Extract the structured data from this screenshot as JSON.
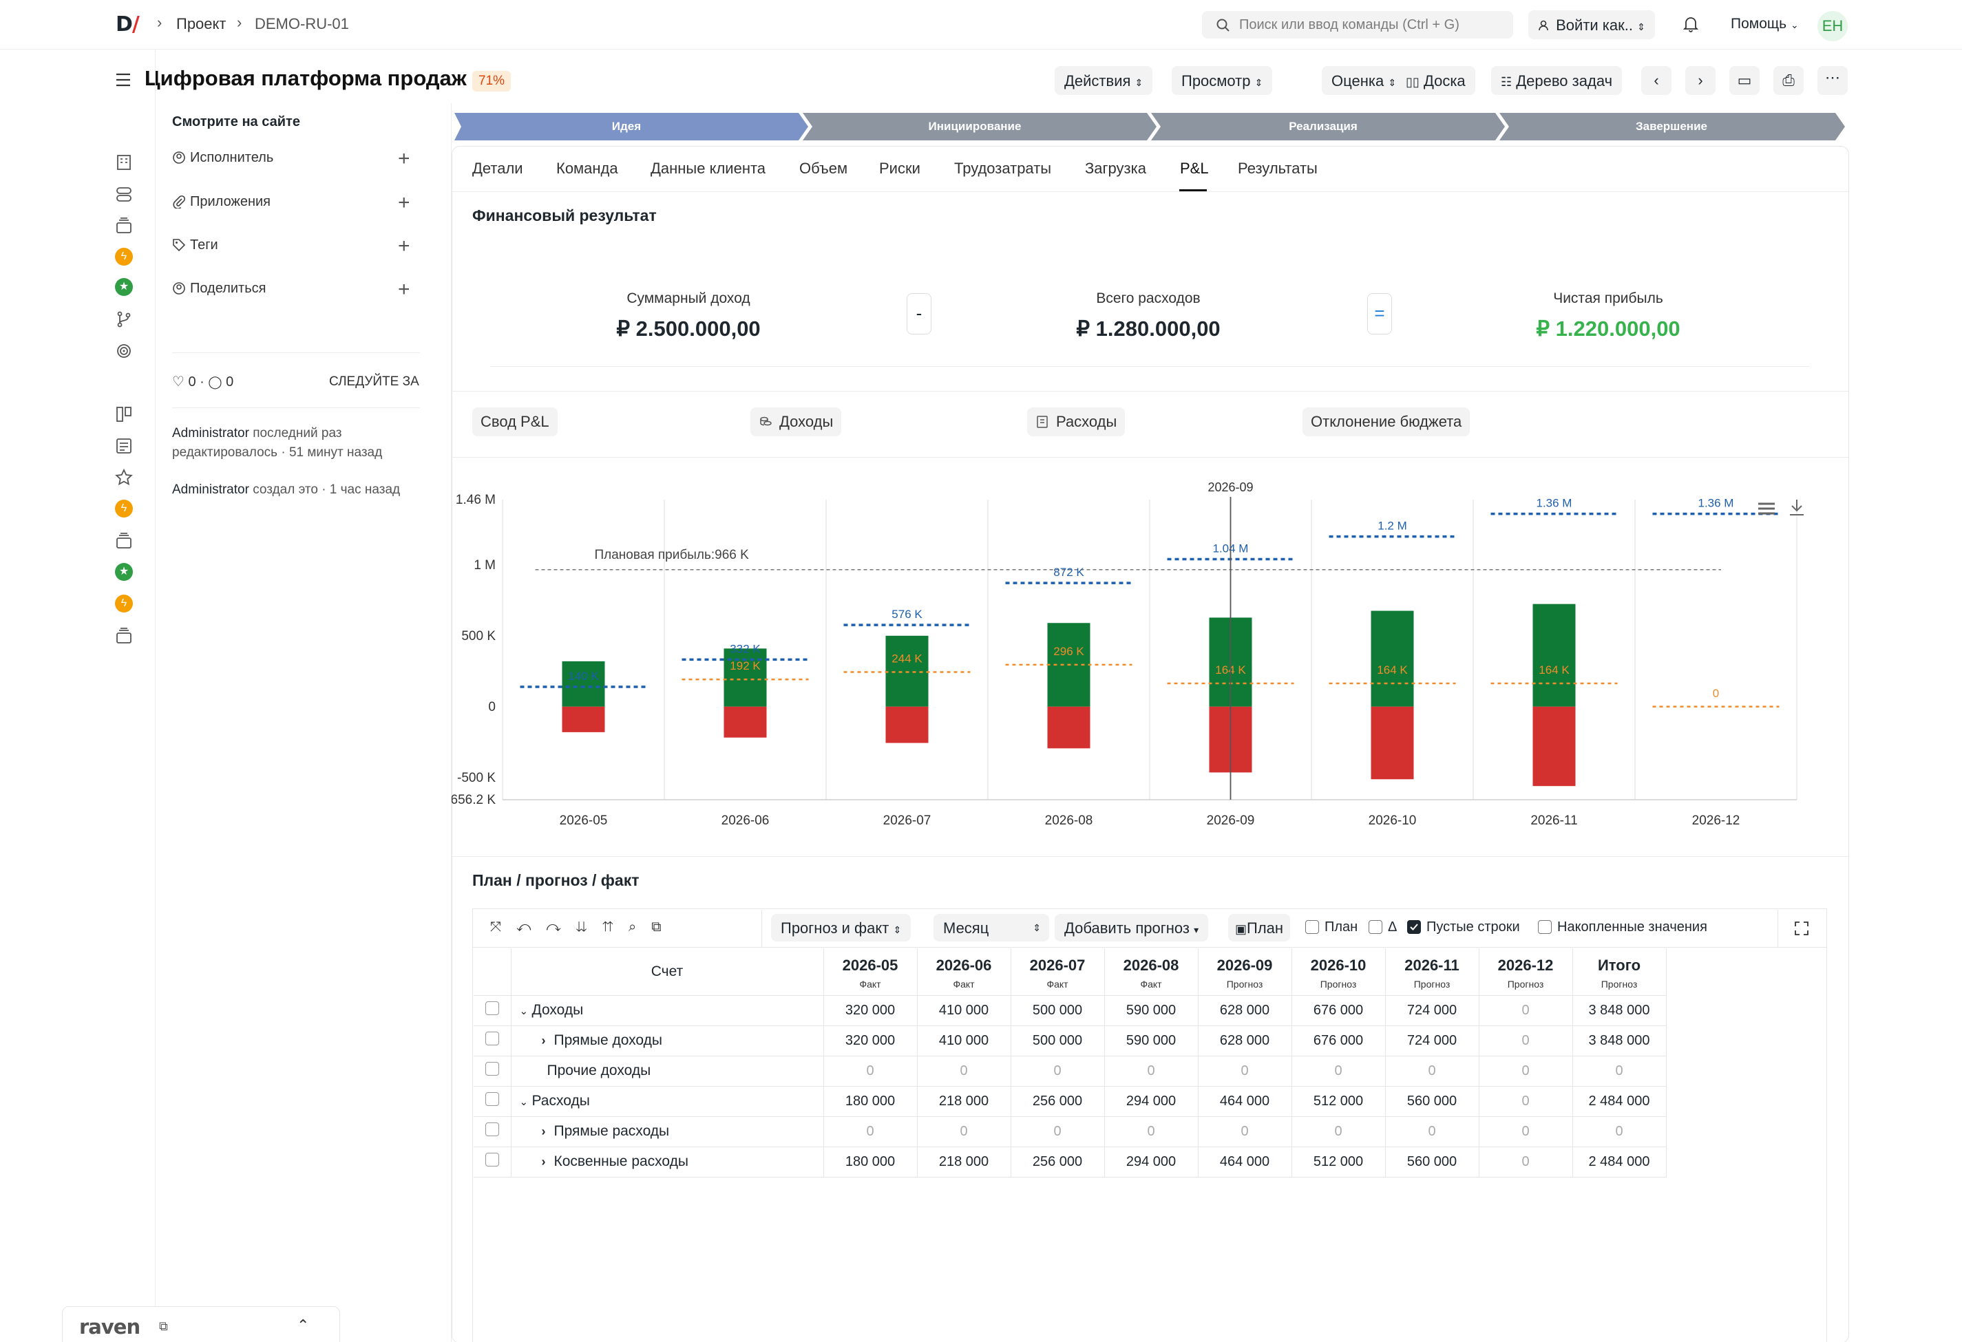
{
  "topbar": {
    "logo": "D/",
    "crumb_project": "Проект",
    "crumb_code": "DEMO-RU-01",
    "search_placeholder": "Поиск или ввод команды (Ctrl + G)",
    "login_as": "Войти как..",
    "help": "Помощь",
    "avatar": "EH"
  },
  "header": {
    "title": "Цифровая платформа продаж",
    "progress": "71%",
    "actions": [
      "Действия",
      "Просмотр",
      "Оценка",
      "Доска",
      "Дерево задач"
    ]
  },
  "sidebar": {
    "title": "Смотрите на сайте",
    "items": [
      {
        "label": "Исполнитель",
        "icon": "user-icon"
      },
      {
        "label": "Приложения",
        "icon": "paperclip-icon"
      },
      {
        "label": "Теги",
        "icon": "tag-icon"
      },
      {
        "label": "Поделиться",
        "icon": "share-icon"
      }
    ],
    "likes": "0",
    "comments": "0",
    "follow": "СЛЕДУЙТЕ ЗА",
    "activity": [
      {
        "who": "Administrator",
        "text": "последний раз редактировалось · 51 минут назад"
      },
      {
        "who": "Administrator",
        "text": "создал это · 1 час назад"
      }
    ]
  },
  "stages": [
    "Идея",
    "Инициирование",
    "Реализация",
    "Завершение"
  ],
  "tabs": [
    "Детали",
    "Команда",
    "Данные клиента",
    "Объем",
    "Риски",
    "Трудозатраты",
    "Загрузка",
    "P&L",
    "Результаты"
  ],
  "active_tab": "P&L",
  "financial": {
    "title": "Финансовый результат",
    "income_label": "Суммарный доход",
    "income": "₽ 2.500.000,00",
    "minus": "-",
    "expense_label": "Всего расходов",
    "expense": "₽ 1.280.000,00",
    "equals": "=",
    "profit_label": "Чистая прибыль",
    "profit": "₽ 1.220.000,00",
    "profit_color": "#37b24d"
  },
  "subtabs": [
    "Свод P&L",
    "Доходы",
    "Расходы",
    "Отклонение бюджета"
  ],
  "chart_data": {
    "type": "bar",
    "categories": [
      "2026-05",
      "2026-06",
      "2026-07",
      "2026-08",
      "2026-09",
      "2026-10",
      "2026-11",
      "2026-12"
    ],
    "y_tick_labels": [
      "1.46 M",
      "1 M",
      "500 K",
      "0",
      "-500 K",
      "-656.2 K"
    ],
    "y_ticks": [
      1460000,
      1000000,
      500000,
      0,
      -500000,
      -656200
    ],
    "ylim": [
      -656200,
      1460000
    ],
    "hover_category": "2026-09",
    "series": [
      {
        "values": [
          320000,
          410000,
          500000,
          590000,
          628000,
          676000,
          724000,
          0
        ],
        "color": "#0e7a36"
      },
      {
        "values": [
          -180000,
          -218000,
          -256000,
          -294000,
          -464000,
          -512000,
          -560000,
          0
        ],
        "color": "#d3312f"
      }
    ],
    "plan_line": {
      "values": [
        140000,
        332000,
        576000,
        872000,
        1040000,
        1200000,
        1360000,
        1360000
      ],
      "labels": [
        "140 K",
        "332 K",
        "576 K",
        "872 K",
        "1.04 M",
        "1.2 M",
        "1.36 M",
        "1.36 M"
      ],
      "color": "#1e5fae"
    },
    "forecast_line": {
      "values": [
        null,
        192000,
        244000,
        296000,
        164000,
        164000,
        164000,
        0
      ],
      "labels": [
        "",
        "192 K",
        "244 K",
        "296 K",
        "164 K",
        "164 K",
        "164 K",
        "0"
      ],
      "color": "#f08c2a"
    },
    "planned_profit": {
      "value": 966000,
      "label": "Плановая прибыль:966 K"
    }
  },
  "plan": {
    "title": "План / прогноз / факт",
    "toolbar": {
      "view": "Прогноз и факт",
      "period": "Месяц",
      "add": "Добавить прогноз",
      "plan_btn": "План",
      "chk_plan": "План",
      "chk_delta": "Δ",
      "chk_empty": "Пустые строки",
      "chk_cum": "Накопленные значения"
    },
    "account_header": "Счет",
    "columns": [
      {
        "m": "2026-05",
        "s": "Факт"
      },
      {
        "m": "2026-06",
        "s": "Факт"
      },
      {
        "m": "2026-07",
        "s": "Факт"
      },
      {
        "m": "2026-08",
        "s": "Факт"
      },
      {
        "m": "2026-09",
        "s": "Прогноз"
      },
      {
        "m": "2026-10",
        "s": "Прогноз"
      },
      {
        "m": "2026-11",
        "s": "Прогноз"
      },
      {
        "m": "2026-12",
        "s": "Прогноз"
      },
      {
        "m": "Итого",
        "s": "Прогноз"
      }
    ],
    "rows": [
      {
        "label": "Доходы",
        "level": 0,
        "toggle": "open",
        "values": [
          "320 000",
          "410 000",
          "500 000",
          "590 000",
          "628 000",
          "676 000",
          "724 000",
          "0",
          "3 848 000"
        ]
      },
      {
        "label": "Прямые доходы",
        "level": 1,
        "toggle": "closed",
        "values": [
          "320 000",
          "410 000",
          "500 000",
          "590 000",
          "628 000",
          "676 000",
          "724 000",
          "0",
          "3 848 000"
        ]
      },
      {
        "label": "Прочие доходы",
        "level": 1,
        "toggle": "none",
        "values": [
          "0",
          "0",
          "0",
          "0",
          "0",
          "0",
          "0",
          "0",
          "0"
        ]
      },
      {
        "label": "Расходы",
        "level": 0,
        "toggle": "open",
        "values": [
          "180 000",
          "218 000",
          "256 000",
          "294 000",
          "464 000",
          "512 000",
          "560 000",
          "0",
          "2 484 000"
        ]
      },
      {
        "label": "Прямые расходы",
        "level": 1,
        "toggle": "closed",
        "values": [
          "0",
          "0",
          "0",
          "0",
          "0",
          "0",
          "0",
          "0",
          "0"
        ]
      },
      {
        "label": "Косвенные расходы",
        "level": 1,
        "toggle": "closed",
        "values": [
          "180 000",
          "218 000",
          "256 000",
          "294 000",
          "464 000",
          "512 000",
          "560 000",
          "0",
          "2 484 000"
        ]
      }
    ]
  },
  "footer": {
    "brand": "raven"
  }
}
